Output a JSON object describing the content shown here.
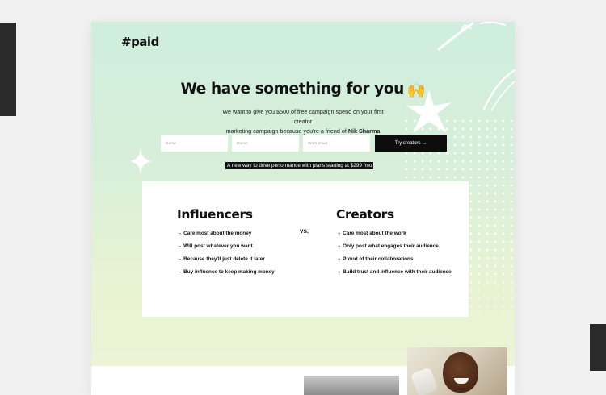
{
  "page": {
    "logo": "#paid",
    "headline": "We have something for you",
    "headline_emoji": "🙌",
    "subtext_line1": "We want to give you $500 of free campaign spend on your first creator",
    "subtext_line2": "marketing campaign because you're a friend of",
    "friend_name": "Nik Sharma"
  },
  "form": {
    "name_placeholder": "Name",
    "brand_placeholder": "Brand",
    "email_placeholder": "Work email",
    "submit_label": "Try creators →"
  },
  "promo": "A new way to drive performance with plans starting at $299 /mo",
  "comparison": {
    "vs_label": "vs.",
    "left": {
      "title": "Influencers",
      "items": [
        "→ Care most about the money",
        "→ Will post whatever you want",
        "→ Because they'll just delete it later",
        "→ Buy influence to keep making money"
      ]
    },
    "right": {
      "title": "Creators",
      "items": [
        "→ Care most about the work",
        "→ Only post what engages their audience",
        "→ Proud of their collaborations",
        "→ Build trust and influence with their audience"
      ]
    }
  },
  "colors": {
    "gradient_top": "#cfeedd",
    "gradient_bottom": "#eef3d7",
    "button_bg": "#0d0d0d",
    "text": "#111111"
  },
  "icons": [
    "raising-hands-emoji",
    "sparkle-star-icon",
    "star-burst-icon",
    "swoosh-lines-icon"
  ]
}
